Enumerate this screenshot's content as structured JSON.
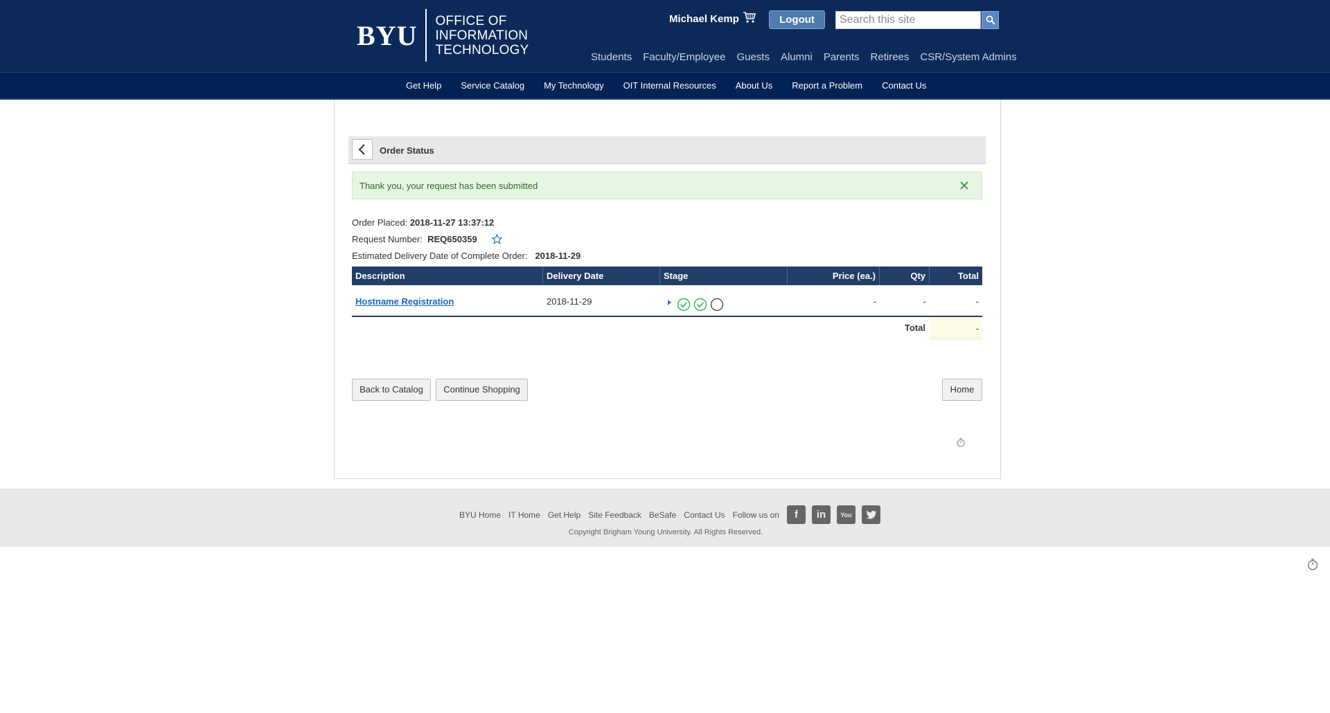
{
  "header": {
    "logo_main": "BYU",
    "logo_line1": "OFFICE OF",
    "logo_line2": "INFORMATION",
    "logo_line3": "TECHNOLOGY",
    "user_name": "Michael Kemp",
    "logout_label": "Logout",
    "search_placeholder": "Search this site",
    "audience_links": [
      "Students",
      "Faculty/Employee",
      "Guests",
      "Alumni",
      "Parents",
      "Retirees",
      "CSR/System Admins"
    ]
  },
  "nav": {
    "items": [
      "Get Help",
      "Service Catalog",
      "My Technology",
      "OIT Internal Resources",
      "About Us",
      "Report a Problem",
      "Contact Us"
    ]
  },
  "order": {
    "title": "Order Status",
    "alert_text": "Thank you, your request has been submitted",
    "placed_label": "Order Placed:",
    "placed_value": "2018-11-27 13:37:12",
    "request_label": "Request Number:",
    "request_value": "REQ650359",
    "delivery_label": "Estimated Delivery Date of Complete Order:",
    "delivery_value": "2018-11-29",
    "table": {
      "headers": [
        "Description",
        "Delivery Date",
        "Stage",
        "Price (ea.)",
        "Qty",
        "Total"
      ],
      "rows": [
        {
          "description": "Hostname Registration",
          "delivery_date": "2018-11-29",
          "stage": [
            "complete",
            "complete",
            "pending"
          ],
          "price": "-",
          "qty": "-",
          "total": "-"
        }
      ],
      "total_label": "Total",
      "total_value": "-"
    },
    "buttons": {
      "back": "Back to Catalog",
      "continue": "Continue Shopping",
      "home": "Home"
    }
  },
  "footer": {
    "links": [
      "BYU Home",
      "IT Home",
      "Get Help",
      "Site Feedback",
      "BeSafe",
      "Contact Us"
    ],
    "follow_label": "Follow us on",
    "social": [
      "facebook-icon",
      "linkedin-icon",
      "youtube-icon",
      "twitter-icon"
    ],
    "copyright": "Copyright Brigham Young University. All Rights Reserved."
  },
  "colors": {
    "header_bg": "#0c2a59",
    "nav_bg": "#002255",
    "table_header": "#223e66",
    "link": "#1a65c2",
    "alert_bg": "#e6f6e3",
    "stage_complete": "#2db84b"
  }
}
